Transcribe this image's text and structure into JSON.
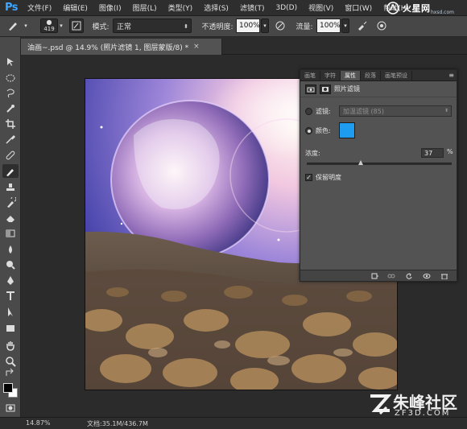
{
  "app": {
    "logo_text": "Ps",
    "brand_watermark_top": "火星网",
    "brand_watermark_sub": "hxsd.com"
  },
  "menu": {
    "items": [
      "文件(F)",
      "编辑(E)",
      "图像(I)",
      "图层(L)",
      "类型(Y)",
      "选择(S)",
      "滤镜(T)",
      "3D(D)",
      "视图(V)",
      "窗口(W)",
      "帮助(H)"
    ]
  },
  "options": {
    "brush_size": "419",
    "mode_label": "模式:",
    "mode_value": "正常",
    "opacity_label": "不透明度:",
    "opacity_value": "100%",
    "flow_label": "流量:",
    "flow_value": "100%"
  },
  "document": {
    "tab_title": "油画~.psd @ 14.9% (照片滤镜 1, 图层蒙版/8) *",
    "close_glyph": "×"
  },
  "panel": {
    "tabs": [
      "画笔",
      "字符",
      "属性",
      "段落",
      "画笔预设"
    ],
    "active_tab_index": 2,
    "title": "照片滤镜",
    "filter_label": "滤镜:",
    "filter_value": "加温滤镜 (85)",
    "color_label": "颜色:",
    "color_hex": "#1d9cf0",
    "selected_option": "color",
    "density_label": "浓度:",
    "density_value": "37",
    "density_unit": "%",
    "density_percent": 37,
    "preserve_luminosity_label": "保留明度",
    "preserve_luminosity_checked": true
  },
  "status": {
    "zoom": "14.87%",
    "doc_size": "文档:35.1M/436.7M"
  },
  "watermark": {
    "title": "朱峰社区",
    "sub": "ZF3D.COM"
  }
}
